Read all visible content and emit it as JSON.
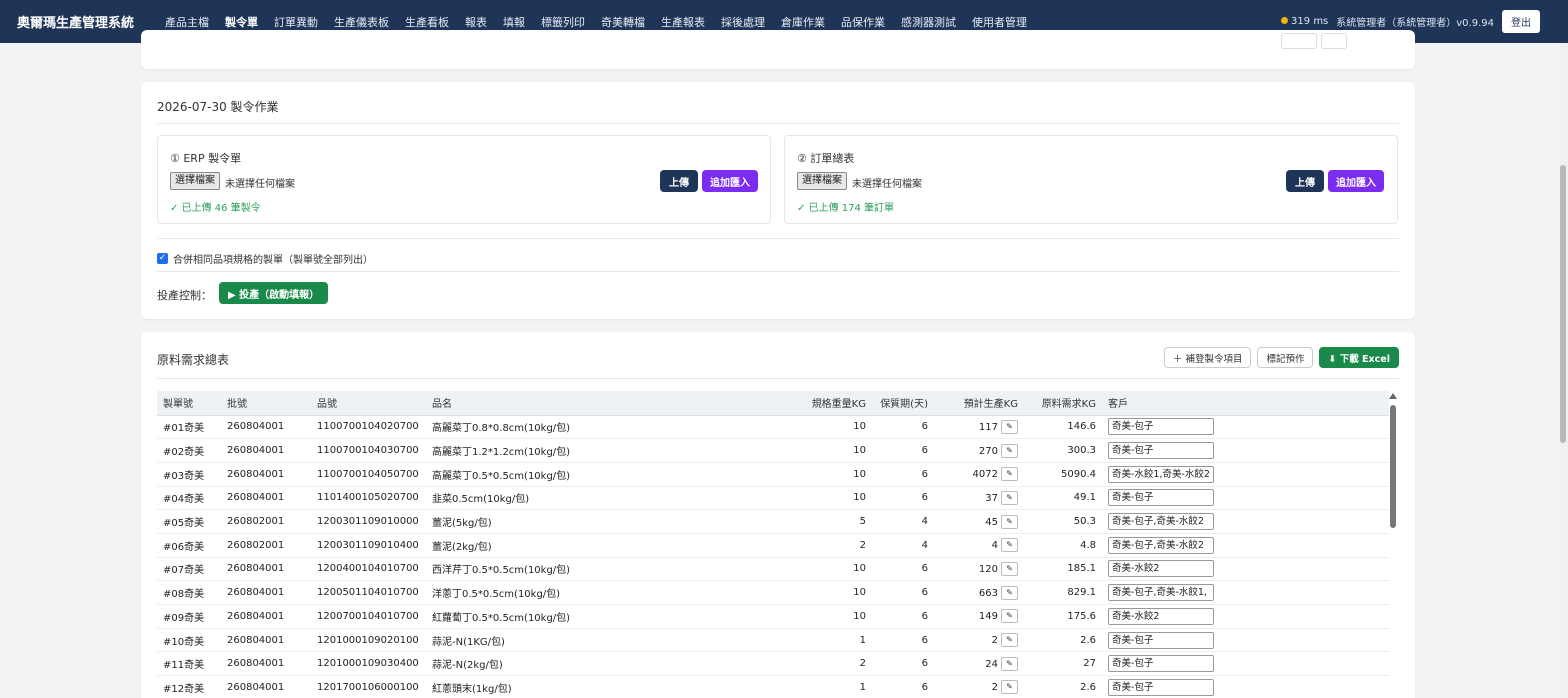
{
  "app": {
    "title": "奧爾瑪生產管理系統",
    "nav": [
      "產品主檔",
      "製令單",
      "訂單異動",
      "生產儀表板",
      "生產看板",
      "報表",
      "填報",
      "標籤列印",
      "奇美轉檔",
      "生產報表",
      "採後處理",
      "倉庫作業",
      "品保作業",
      "感測器測試",
      "使用者管理"
    ],
    "active_nav_index": 1,
    "latency": "319 ms",
    "user": "系統管理者（系統管理者）v0.9.94",
    "logout_label": "登出"
  },
  "ops": {
    "title": "2026-07-30 製令作業",
    "erp": {
      "title": "① ERP 製令單",
      "file_button": "選擇檔案",
      "file_none": "未選擇任何檔案",
      "upload_label": "上傳",
      "append_label": "追加匯入",
      "status": "✓ 已上傳 46 筆製令"
    },
    "orders": {
      "title": "② 訂單總表",
      "file_button": "選擇檔案",
      "file_none": "未選擇任何檔案",
      "upload_label": "上傳",
      "append_label": "追加匯入",
      "status": "✓ 已上傳 174 筆訂單"
    },
    "merge_label": "合併相同品項規格的製單（製單號全部列出）",
    "production_label": "投產控制：",
    "production_button": "▶ 投產（啟動填報）"
  },
  "requirements": {
    "title": "原料需求總表",
    "add_button": "＋ 補登製令項目",
    "mark_button": "標記預作",
    "excel_button": "⬇ 下載 Excel",
    "headers": [
      "製單號",
      "批號",
      "品號",
      "品名",
      "規格重量KG",
      "保質期(天)",
      "預計生產KG",
      "原料需求KG",
      "客戶"
    ],
    "rows": [
      [
        "#01奇美",
        "260804001",
        "1100700104020700",
        "高麗菜丁0.8*0.8cm(10kg/包)",
        "10",
        "6",
        "117",
        "146.6",
        "奇美-包子"
      ],
      [
        "#02奇美",
        "260804001",
        "1100700104030700",
        "高麗菜丁1.2*1.2cm(10kg/包)",
        "10",
        "6",
        "270",
        "300.3",
        "奇美-包子"
      ],
      [
        "#03奇美",
        "260804001",
        "1100700104050700",
        "高麗菜丁0.5*0.5cm(10kg/包)",
        "10",
        "6",
        "4072",
        "5090.4",
        "奇美-水餃1,奇美-水餃2"
      ],
      [
        "#04奇美",
        "260804001",
        "1101400105020700",
        "韭菜0.5cm(10kg/包)",
        "10",
        "6",
        "37",
        "49.1",
        "奇美-包子"
      ],
      [
        "#05奇美",
        "260802001",
        "1200301109010000",
        "薑泥(5kg/包)",
        "5",
        "4",
        "45",
        "50.3",
        "奇美-包子,奇美-水餃2"
      ],
      [
        "#06奇美",
        "260802001",
        "1200301109010400",
        "薑泥(2kg/包)",
        "2",
        "4",
        "4",
        "4.8",
        "奇美-包子,奇美-水餃2"
      ],
      [
        "#07奇美",
        "260804001",
        "1200400104010700",
        "西洋芹丁0.5*0.5cm(10kg/包)",
        "10",
        "6",
        "120",
        "185.1",
        "奇美-水餃2"
      ],
      [
        "#08奇美",
        "260804001",
        "1200501104010700",
        "洋蔥丁0.5*0.5cm(10kg/包)",
        "10",
        "6",
        "663",
        "829.1",
        "奇美-包子,奇美-水餃1,"
      ],
      [
        "#09奇美",
        "260804001",
        "1200700104010700",
        "紅蘿蔔丁0.5*0.5cm(10kg/包)",
        "10",
        "6",
        "149",
        "175.6",
        "奇美-水餃2"
      ],
      [
        "#10奇美",
        "260804001",
        "1201000109020100",
        "蒜泥-N(1KG/包)",
        "1",
        "6",
        "2",
        "2.6",
        "奇美-包子"
      ],
      [
        "#11奇美",
        "260804001",
        "1201000109030400",
        "蒜泥-N(2kg/包)",
        "2",
        "6",
        "24",
        "27",
        "奇美-包子"
      ],
      [
        "#12奇美",
        "260804001",
        "1201700106000100",
        "紅蔥頭末(1kg/包)",
        "1",
        "6",
        "2",
        "2.6",
        "奇美-包子"
      ]
    ]
  },
  "colors": {
    "navbar": "#1e3558",
    "accent_green": "#1a8a4a",
    "accent_purple": "#7a2cf0",
    "ok_text": "#2e9e5b"
  }
}
